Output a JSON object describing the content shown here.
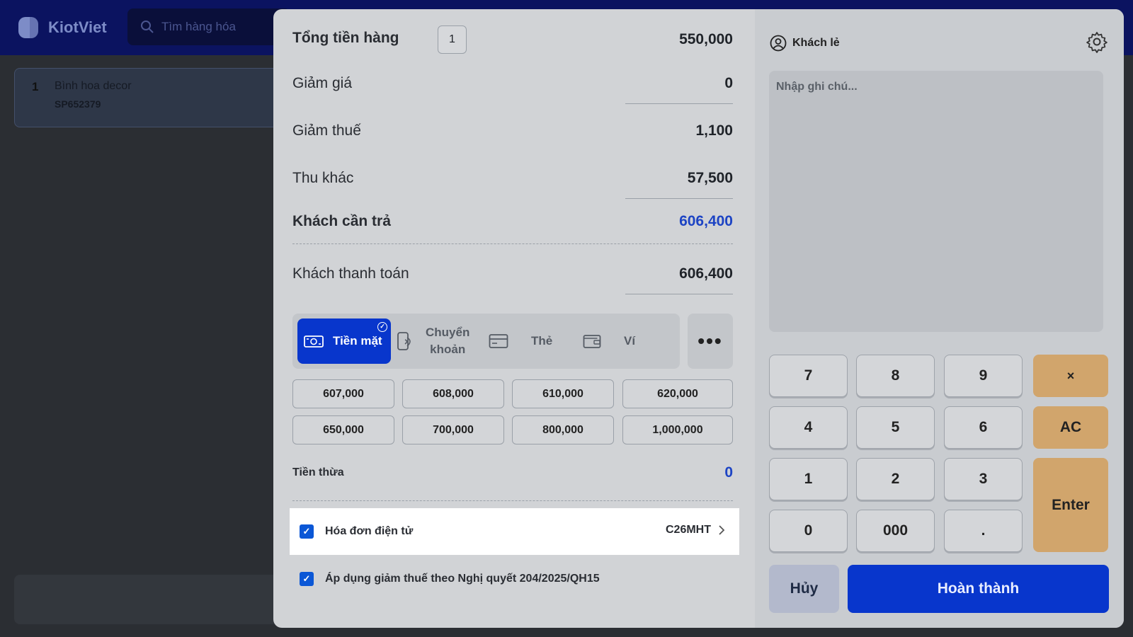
{
  "app": {
    "logo_text": "KiotViet",
    "search_placeholder": "Tìm hàng hóa",
    "cart_item": {
      "index": "1",
      "name": "Bình hoa decor",
      "code": "SP652379"
    }
  },
  "summary": {
    "total_label": "Tổng tiền hàng",
    "total_qty": "1",
    "total_value": "550,000",
    "discount_label": "Giảm giá",
    "discount_value": "0",
    "tax_reduction_label": "Giảm thuế",
    "tax_reduction_value": "1,100",
    "other_fee_label": "Thu khác",
    "other_fee_value": "57,500",
    "due_label": "Khách cần trả",
    "due_value": "606,400",
    "paid_label": "Khách thanh toán",
    "paid_value": "606,400",
    "change_label": "Tiền thừa",
    "change_value": "0"
  },
  "payment_methods": {
    "cash": "Tiền mặt",
    "transfer_line1": "Chuyển",
    "transfer_line2": "khoản",
    "card": "Thẻ",
    "wallet": "Ví",
    "more": "•••",
    "selected": "cash"
  },
  "quick_amounts": [
    "607,000",
    "608,000",
    "610,000",
    "620,000",
    "650,000",
    "700,000",
    "800,000",
    "1,000,000"
  ],
  "options": {
    "einvoice_label": "Hóa đơn điện tử",
    "einvoice_code": "C26MHT",
    "einvoice_checked": true,
    "tax_rule_label": "Áp dụng giảm thuế theo Nghị quyết 204/2025/QH15",
    "tax_rule_checked": true
  },
  "customer": {
    "name": "Khách lẻ",
    "note_placeholder": "Nhập ghi chú..."
  },
  "keypad": {
    "k7": "7",
    "k8": "8",
    "k9": "9",
    "times": "×",
    "k4": "4",
    "k5": "5",
    "k6": "6",
    "ac": "AC",
    "k1": "1",
    "k2": "2",
    "k3": "3",
    "enter": "Enter",
    "k0": "0",
    "k000": "000",
    "dot": "."
  },
  "actions": {
    "cancel": "Hủy",
    "done": "Hoàn thành"
  },
  "colors": {
    "primary": "#0836cc",
    "accent_blue_text": "#1d44c4",
    "operator_key": "#d1a56c"
  }
}
